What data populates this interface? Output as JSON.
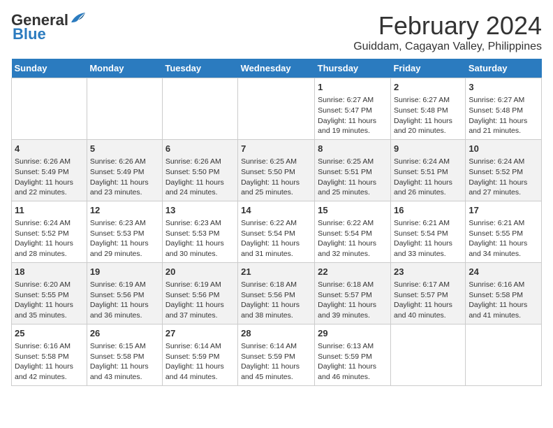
{
  "header": {
    "logo_line1": "General",
    "logo_line2": "Blue",
    "title": "February 2024",
    "subtitle": "Guiddam, Cagayan Valley, Philippines"
  },
  "days_of_week": [
    "Sunday",
    "Monday",
    "Tuesday",
    "Wednesday",
    "Thursday",
    "Friday",
    "Saturday"
  ],
  "weeks": [
    [
      {
        "day": "",
        "info": ""
      },
      {
        "day": "",
        "info": ""
      },
      {
        "day": "",
        "info": ""
      },
      {
        "day": "",
        "info": ""
      },
      {
        "day": "1",
        "info": "Sunrise: 6:27 AM\nSunset: 5:47 PM\nDaylight: 11 hours and 19 minutes."
      },
      {
        "day": "2",
        "info": "Sunrise: 6:27 AM\nSunset: 5:48 PM\nDaylight: 11 hours and 20 minutes."
      },
      {
        "day": "3",
        "info": "Sunrise: 6:27 AM\nSunset: 5:48 PM\nDaylight: 11 hours and 21 minutes."
      }
    ],
    [
      {
        "day": "4",
        "info": "Sunrise: 6:26 AM\nSunset: 5:49 PM\nDaylight: 11 hours and 22 minutes."
      },
      {
        "day": "5",
        "info": "Sunrise: 6:26 AM\nSunset: 5:49 PM\nDaylight: 11 hours and 23 minutes."
      },
      {
        "day": "6",
        "info": "Sunrise: 6:26 AM\nSunset: 5:50 PM\nDaylight: 11 hours and 24 minutes."
      },
      {
        "day": "7",
        "info": "Sunrise: 6:25 AM\nSunset: 5:50 PM\nDaylight: 11 hours and 25 minutes."
      },
      {
        "day": "8",
        "info": "Sunrise: 6:25 AM\nSunset: 5:51 PM\nDaylight: 11 hours and 25 minutes."
      },
      {
        "day": "9",
        "info": "Sunrise: 6:24 AM\nSunset: 5:51 PM\nDaylight: 11 hours and 26 minutes."
      },
      {
        "day": "10",
        "info": "Sunrise: 6:24 AM\nSunset: 5:52 PM\nDaylight: 11 hours and 27 minutes."
      }
    ],
    [
      {
        "day": "11",
        "info": "Sunrise: 6:24 AM\nSunset: 5:52 PM\nDaylight: 11 hours and 28 minutes."
      },
      {
        "day": "12",
        "info": "Sunrise: 6:23 AM\nSunset: 5:53 PM\nDaylight: 11 hours and 29 minutes."
      },
      {
        "day": "13",
        "info": "Sunrise: 6:23 AM\nSunset: 5:53 PM\nDaylight: 11 hours and 30 minutes."
      },
      {
        "day": "14",
        "info": "Sunrise: 6:22 AM\nSunset: 5:54 PM\nDaylight: 11 hours and 31 minutes."
      },
      {
        "day": "15",
        "info": "Sunrise: 6:22 AM\nSunset: 5:54 PM\nDaylight: 11 hours and 32 minutes."
      },
      {
        "day": "16",
        "info": "Sunrise: 6:21 AM\nSunset: 5:54 PM\nDaylight: 11 hours and 33 minutes."
      },
      {
        "day": "17",
        "info": "Sunrise: 6:21 AM\nSunset: 5:55 PM\nDaylight: 11 hours and 34 minutes."
      }
    ],
    [
      {
        "day": "18",
        "info": "Sunrise: 6:20 AM\nSunset: 5:55 PM\nDaylight: 11 hours and 35 minutes."
      },
      {
        "day": "19",
        "info": "Sunrise: 6:19 AM\nSunset: 5:56 PM\nDaylight: 11 hours and 36 minutes."
      },
      {
        "day": "20",
        "info": "Sunrise: 6:19 AM\nSunset: 5:56 PM\nDaylight: 11 hours and 37 minutes."
      },
      {
        "day": "21",
        "info": "Sunrise: 6:18 AM\nSunset: 5:56 PM\nDaylight: 11 hours and 38 minutes."
      },
      {
        "day": "22",
        "info": "Sunrise: 6:18 AM\nSunset: 5:57 PM\nDaylight: 11 hours and 39 minutes."
      },
      {
        "day": "23",
        "info": "Sunrise: 6:17 AM\nSunset: 5:57 PM\nDaylight: 11 hours and 40 minutes."
      },
      {
        "day": "24",
        "info": "Sunrise: 6:16 AM\nSunset: 5:58 PM\nDaylight: 11 hours and 41 minutes."
      }
    ],
    [
      {
        "day": "25",
        "info": "Sunrise: 6:16 AM\nSunset: 5:58 PM\nDaylight: 11 hours and 42 minutes."
      },
      {
        "day": "26",
        "info": "Sunrise: 6:15 AM\nSunset: 5:58 PM\nDaylight: 11 hours and 43 minutes."
      },
      {
        "day": "27",
        "info": "Sunrise: 6:14 AM\nSunset: 5:59 PM\nDaylight: 11 hours and 44 minutes."
      },
      {
        "day": "28",
        "info": "Sunrise: 6:14 AM\nSunset: 5:59 PM\nDaylight: 11 hours and 45 minutes."
      },
      {
        "day": "29",
        "info": "Sunrise: 6:13 AM\nSunset: 5:59 PM\nDaylight: 11 hours and 46 minutes."
      },
      {
        "day": "",
        "info": ""
      },
      {
        "day": "",
        "info": ""
      }
    ]
  ]
}
